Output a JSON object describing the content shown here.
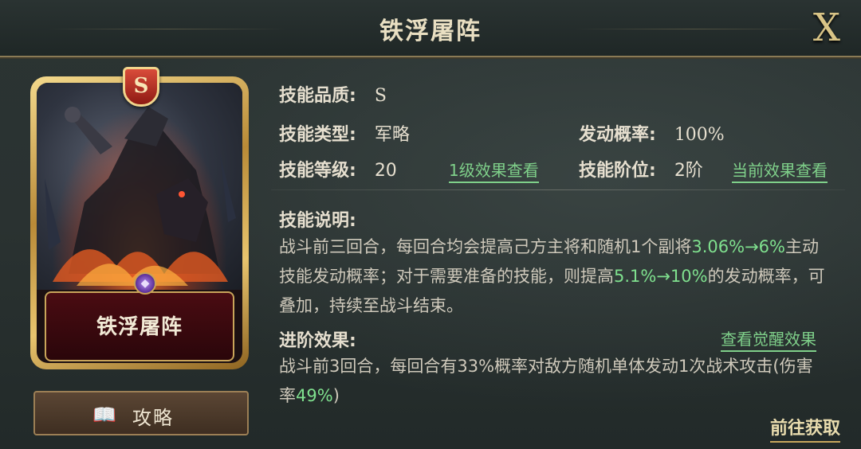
{
  "header": {
    "title": "铁浮屠阵",
    "close_label": "X"
  },
  "card": {
    "grade": "S",
    "name": "铁浮屠阵",
    "gem_icon": "gem-icon"
  },
  "guide_button": {
    "label": "攻略",
    "icon": "book-icon"
  },
  "info": {
    "quality": {
      "key": "技能品质:",
      "value": "S"
    },
    "type": {
      "key": "技能类型:",
      "value": "军略"
    },
    "trigger_rate": {
      "key": "发动概率:",
      "value": "100%"
    },
    "level": {
      "key": "技能等级:",
      "value": "20"
    },
    "level1_link": "1级效果查看",
    "tier": {
      "key": "技能阶位:",
      "value": "2阶"
    },
    "current_link": "当前效果查看"
  },
  "description": {
    "heading": "技能说明:",
    "parts": [
      "战斗前三回合，每回合均会提高己方主将和随机1个副将",
      "3.06%→6%",
      "主动技能发动概率；对于需要准备的技能，则提高",
      "5.1%→10%",
      "的发动概率，可叠加，持续至战斗结束。"
    ]
  },
  "advance": {
    "heading": "进阶效果:",
    "link": "查看觉醒效果",
    "parts": [
      "战斗前3回合，每回合有33%概率对敌方随机单体发动1次战术攻击(伤害率",
      "49%",
      ")"
    ]
  },
  "go_button": "前往获取",
  "colors": {
    "highlight": "#7fe08e",
    "link": "#7fd08a",
    "gold": "#c9a55a"
  }
}
